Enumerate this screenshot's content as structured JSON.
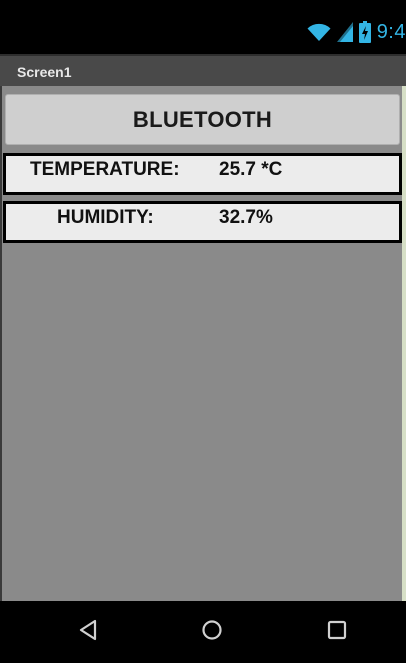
{
  "status_bar": {
    "time": "9:4",
    "icons": [
      "wifi-icon",
      "signal-icon",
      "battery-charging-icon"
    ]
  },
  "app": {
    "title": "Screen1"
  },
  "bluetooth_button": {
    "label": "BLUETOOTH"
  },
  "readings": {
    "temperature": {
      "label": "TEMPERATURE:",
      "value": "25.7 *C"
    },
    "humidity": {
      "label": "HUMIDITY:",
      "value": "32.7%"
    }
  },
  "nav_bar": {
    "buttons": [
      "back-icon",
      "home-icon",
      "recent-apps-icon"
    ]
  },
  "colors": {
    "status_accent": "#33b5e5",
    "title_bar": "#494949",
    "content_background": "#8a8a8a",
    "button_background": "#cfcfcf",
    "row_background": "#ececec"
  }
}
